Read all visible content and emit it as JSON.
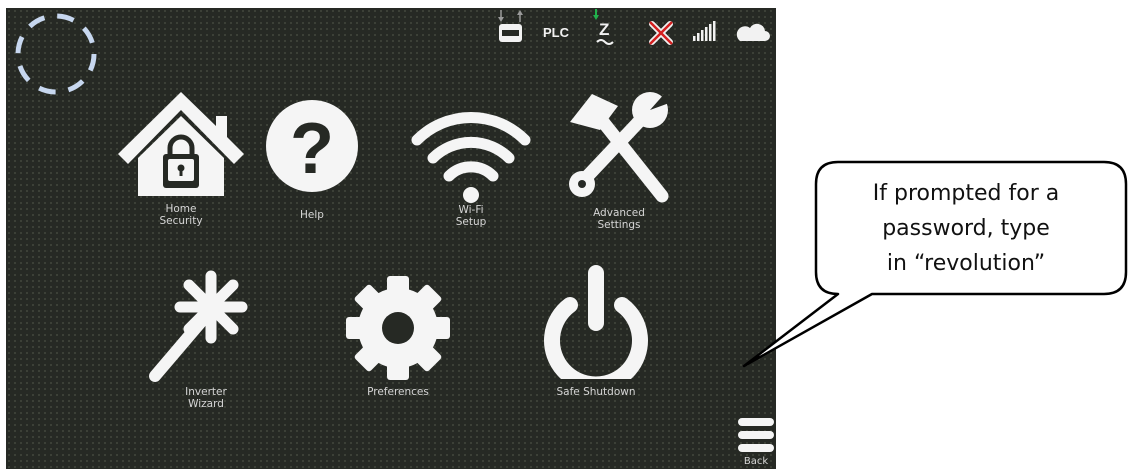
{
  "status_bar": {
    "plc_label": "PLC",
    "z_label": "Z",
    "icons": [
      "network-transfer-icon",
      "plc-icon",
      "zigbee-icon",
      "disconnected-x-icon",
      "signal-bars-icon",
      "cloud-icon"
    ],
    "colors": {
      "arrow_green": "#22b14c",
      "x_red": "#d32020"
    }
  },
  "menu": {
    "home_security": {
      "line1": "Home",
      "line2": "Security",
      "icon": "house-lock-icon"
    },
    "help": {
      "line1": "Help",
      "icon": "question-circle-icon"
    },
    "wifi_setup": {
      "line1": "Wi-Fi",
      "line2": "Setup",
      "icon": "wifi-icon"
    },
    "advanced_settings": {
      "line1": "Advanced",
      "line2": "Settings",
      "icon": "tools-icon"
    },
    "inverter_wizard": {
      "line1": "Inverter",
      "line2": "Wizard",
      "icon": "magic-wand-icon"
    },
    "preferences": {
      "line1": "Preferences",
      "icon": "gear-icon"
    },
    "safe_shutdown": {
      "line1": "Safe Shutdown",
      "icon": "power-icon"
    }
  },
  "back": {
    "label": "Back",
    "icon": "hamburger-menu-icon"
  },
  "callout": {
    "line1": "If prompted for a",
    "line2": "password, type",
    "line3": "in “revolution”"
  },
  "colors": {
    "screen_bg": "#262924",
    "icon_white": "#f5f5f5",
    "label_gray": "#d6d6d6",
    "spinner_blue": "#c7d7ef"
  }
}
